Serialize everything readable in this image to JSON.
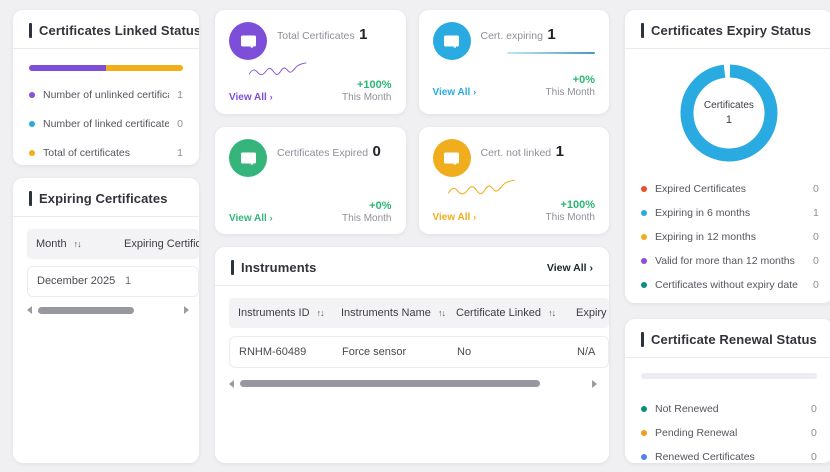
{
  "linked_status": {
    "title": "Certificates Linked Status",
    "bar": {
      "left_color": "#7d4fd9",
      "left_width": "50%",
      "right_color": "#f2ae19",
      "right_width": "50%"
    },
    "legend": [
      {
        "label": "Number of unlinked certificates",
        "value": "1",
        "color": "#8a4fd9"
      },
      {
        "label": "Number of linked certificates",
        "value": "0",
        "color": "#29abe2"
      },
      {
        "label": "Total of certificates",
        "value": "1",
        "color": "#f0ad1d"
      }
    ]
  },
  "expiring_certificates": {
    "title": "Expiring Certificates",
    "sort_icon": "↑↓",
    "columns": {
      "month": "Month",
      "count": "Expiring Certificates"
    },
    "rows": [
      {
        "month": "December 2025",
        "count": "1"
      }
    ]
  },
  "kpis": [
    {
      "label": "Total Certificates",
      "value": "1",
      "color": "#7d4fd9",
      "view_all": "View All",
      "chevron": "›",
      "delta": "+100%",
      "period": "This Month",
      "delta_color": "#2bb673"
    },
    {
      "label": "Cert. expiring",
      "value": "1",
      "color": "#29abe2",
      "view_all": "View All",
      "chevron": "›",
      "delta": "+0%",
      "period": "This Month",
      "delta_color": "#2bb673"
    },
    {
      "label": "Certificates Expired",
      "value": "0",
      "color": "#35b57c",
      "view_all": "View All",
      "chevron": "›",
      "delta": "+0%",
      "period": "This Month",
      "delta_color": "#2bb673"
    },
    {
      "label": "Cert. not linked",
      "value": "1",
      "color": "#f0ad1d",
      "view_all": "View All",
      "chevron": "›",
      "delta": "+100%",
      "period": "This Month",
      "delta_color": "#2bb673"
    }
  ],
  "instruments": {
    "title": "Instruments",
    "view_all": "View All",
    "chevron": "›",
    "sort_icon": "↑↓",
    "columns": {
      "id": "Instruments ID",
      "name": "Instruments Name",
      "linked": "Certificate Linked",
      "expiry": "Expiry"
    },
    "rows": [
      {
        "id": "RNHM-60489",
        "name": "Force sensor",
        "linked": "No",
        "expiry": "N/A"
      }
    ]
  },
  "expiry_status": {
    "title": "Certificates Expiry Status",
    "donut": {
      "center_label": "Certificates",
      "center_value": "1",
      "color": "#29abe2"
    },
    "legend": [
      {
        "label": "Expired Certificates",
        "value": "0",
        "color": "#e8502a"
      },
      {
        "label": "Expiring in 6 months",
        "value": "1",
        "color": "#29abe2"
      },
      {
        "label": "Expiring in 12 months",
        "value": "0",
        "color": "#f0ad1d"
      },
      {
        "label": "Valid for more than 12 months",
        "value": "0",
        "color": "#8a4fd9"
      },
      {
        "label": "Certificates without expiry date",
        "value": "0",
        "color": "#0a8f7e"
      }
    ]
  },
  "renewal_status": {
    "title": "Certificate Renewal Status",
    "legend": [
      {
        "label": "Not Renewed",
        "value": "0",
        "color": "#0a8f7e"
      },
      {
        "label": "Pending Renewal",
        "value": "0",
        "color": "#f29b1d"
      },
      {
        "label": "Renewed Certificates",
        "value": "0",
        "color": "#4f86ec"
      }
    ]
  },
  "chart_data": [
    {
      "type": "pie",
      "title": "Certificates Expiry Status",
      "categories": [
        "Expired Certificates",
        "Expiring in 6 months",
        "Expiring in 12 months",
        "Valid for more than 12 months",
        "Certificates without expiry date"
      ],
      "values": [
        0,
        1,
        0,
        0,
        0
      ],
      "colors": [
        "#e8502a",
        "#29abe2",
        "#f0ad1d",
        "#8a4fd9",
        "#0a8f7e"
      ],
      "center_label": "Certificates",
      "center_value": 1,
      "legend_position": "bottom"
    },
    {
      "type": "bar",
      "title": "Certificates Linked Status",
      "categories": [
        "Number of unlinked certificates",
        "Number of linked certificates",
        "Total of certificates"
      ],
      "values": [
        1,
        0,
        1
      ],
      "colors": [
        "#8a4fd9",
        "#29abe2",
        "#f0ad1d"
      ],
      "orientation": "horizontal-stacked"
    },
    {
      "type": "table",
      "title": "Expiring Certificates",
      "columns": [
        "Month",
        "Expiring Certificates"
      ],
      "rows": [
        [
          "December 2025",
          1
        ]
      ]
    },
    {
      "type": "table",
      "title": "Instruments",
      "columns": [
        "Instruments ID",
        "Instruments Name",
        "Certificate Linked",
        "Expiry"
      ],
      "rows": [
        [
          "RNHM-60489",
          "Force sensor",
          "No",
          "N/A"
        ]
      ]
    }
  ]
}
